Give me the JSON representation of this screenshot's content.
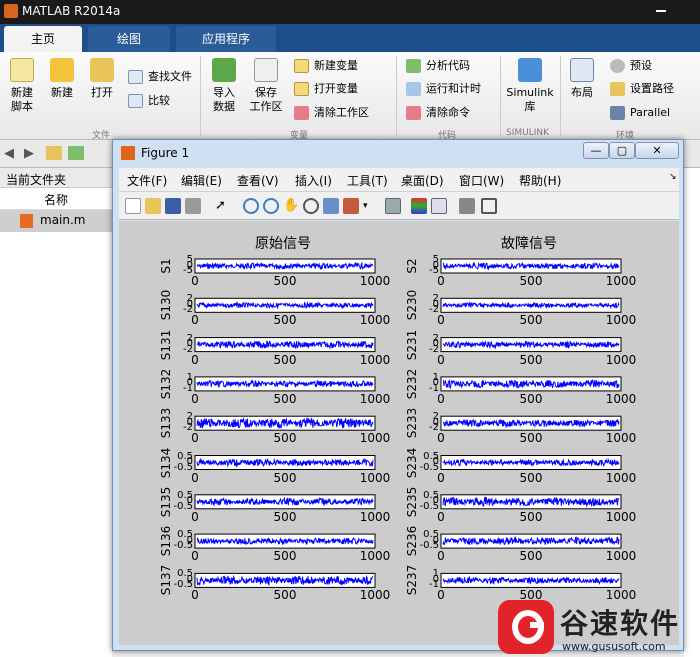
{
  "app": {
    "title": "MATLAB R2014a"
  },
  "tabs": [
    {
      "label": "主页"
    },
    {
      "label": "绘图"
    },
    {
      "label": "应用程序"
    }
  ],
  "ribbon": {
    "new_script": "新建\n脚本",
    "new": "新建",
    "open": "打开",
    "find_files": "查找文件",
    "compare": "比较",
    "import_data": "导入\n数据",
    "save_workspace": "保存\n工作区",
    "new_variable": "新建变量",
    "open_variable": "打开变量",
    "clear_workspace": "清除工作区",
    "analyze_code": "分析代码",
    "run_and_time": "运行和计时",
    "clear_commands": "清除命令",
    "simulink": "Simulink\n库",
    "layout": "布局",
    "preferences": "预设",
    "set_path": "设置路径",
    "parallel": "Parallel",
    "group_file": "文件",
    "group_variable": "变量",
    "group_code": "代码",
    "group_simulink": "SIMULINK",
    "group_env": "环境"
  },
  "current_folder": {
    "header": "当前文件夹",
    "column_name": "名称",
    "file": "main.m"
  },
  "figure": {
    "title": "Figure 1",
    "menu": [
      "文件(F)",
      "编辑(E)",
      "查看(V)",
      "插入(I)",
      "工具(T)",
      "桌面(D)",
      "窗口(W)",
      "帮助(H)"
    ],
    "axes_color": "#0000ff"
  },
  "chart_data": [
    {
      "type": "line",
      "title": "原始信号",
      "xlim": [
        0,
        1000
      ],
      "xticks": [
        0,
        500,
        1000
      ],
      "panels": [
        {
          "ylabel": "S1",
          "yticks": [
            "5",
            "0",
            "-5"
          ],
          "amplitude": 0.5
        },
        {
          "ylabel": "S130",
          "yticks": [
            "2",
            "0",
            "-2"
          ],
          "amplitude": 0.45
        },
        {
          "ylabel": "S131",
          "yticks": [
            "2",
            "0",
            "-2"
          ],
          "amplitude": 0.6
        },
        {
          "ylabel": "S132",
          "yticks": [
            "1",
            "0",
            "-1"
          ],
          "amplitude": 0.55
        },
        {
          "ylabel": "S133",
          "yticks": [
            "2",
            "0",
            "-2"
          ],
          "amplitude": 0.85
        },
        {
          "ylabel": "S134",
          "yticks": [
            "0.5",
            "0",
            "-0.5"
          ],
          "amplitude": 0.6
        },
        {
          "ylabel": "S135",
          "yticks": [
            "0.5",
            "0",
            "-0.5"
          ],
          "amplitude": 0.6
        },
        {
          "ylabel": "S136",
          "yticks": [
            "0.5",
            "0",
            "-0.5"
          ],
          "amplitude": 0.55
        },
        {
          "ylabel": "S137",
          "yticks": [
            "0.5",
            "0",
            "-0.5"
          ],
          "amplitude": 0.75
        }
      ]
    },
    {
      "type": "line",
      "title": "故障信号",
      "xlim": [
        0,
        1000
      ],
      "xticks": [
        0,
        500,
        1000
      ],
      "panels": [
        {
          "ylabel": "S2",
          "yticks": [
            "5",
            "0",
            "-5"
          ],
          "amplitude": 0.5
        },
        {
          "ylabel": "S230",
          "yticks": [
            "2",
            "0",
            "-2"
          ],
          "amplitude": 0.4
        },
        {
          "ylabel": "S231",
          "yticks": [
            "2",
            "0",
            "-2"
          ],
          "amplitude": 0.55
        },
        {
          "ylabel": "S232",
          "yticks": [
            "1",
            "0",
            "-1"
          ],
          "amplitude": 0.7
        },
        {
          "ylabel": "S233",
          "yticks": [
            "2",
            "0",
            "-2"
          ],
          "amplitude": 0.6
        },
        {
          "ylabel": "S234",
          "yticks": [
            "0.5",
            "0",
            "-0.5"
          ],
          "amplitude": 0.55
        },
        {
          "ylabel": "S235",
          "yticks": [
            "0.5",
            "0",
            "-0.5"
          ],
          "amplitude": 0.75
        },
        {
          "ylabel": "S236",
          "yticks": [
            "0.5",
            "0",
            "-0.5"
          ],
          "amplitude": 0.65
        },
        {
          "ylabel": "S237",
          "yticks": [
            "1",
            "0",
            "-1"
          ],
          "amplitude": 0.55
        }
      ]
    }
  ],
  "watermark": {
    "brand": "谷速软件",
    "url": "www.gususoft.com"
  }
}
